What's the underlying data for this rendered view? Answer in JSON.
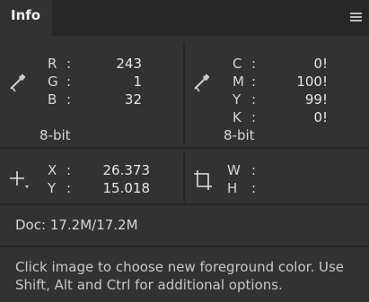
{
  "panel": {
    "tab_label": "Info",
    "menu_icon": "hamburger-menu-icon"
  },
  "rgb": {
    "icon": "eyedropper-icon",
    "labels": [
      "R",
      "G",
      "B"
    ],
    "values": [
      "243",
      "1",
      "32"
    ],
    "mode": "8-bit"
  },
  "cmyk": {
    "icon": "eyedropper-icon",
    "labels": [
      "C",
      "M",
      "Y",
      "K"
    ],
    "values": [
      "0!",
      "100!",
      "99!",
      "0!"
    ],
    "mode": "8-bit"
  },
  "position": {
    "icon": "crosshair-icon",
    "labels": [
      "X",
      "Y"
    ],
    "values": [
      "26.373",
      "15.018"
    ]
  },
  "size": {
    "icon": "selection-size-icon",
    "labels": [
      "W",
      "H"
    ],
    "values": [
      "",
      ""
    ]
  },
  "doc": {
    "text": "Doc: 17.2M/17.2M"
  },
  "hint": {
    "line1": "Click image to choose new foreground color.  Use",
    "line2": "Shift, Alt and Ctrl for additional options."
  }
}
